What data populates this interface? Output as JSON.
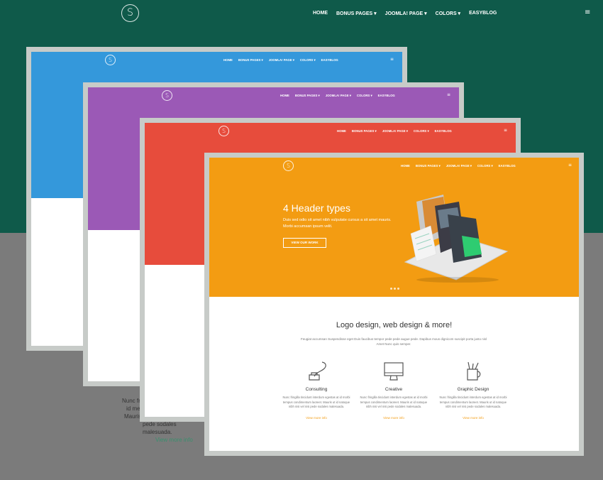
{
  "nav": {
    "logo": "S",
    "items": [
      "HOME",
      "BONUS PAGES ▾",
      "JOOMLA! PAGE ▾",
      "COLORS ▾",
      "EASYBLOG"
    ],
    "menu_icon": "hamburger-menu-icon"
  },
  "background_text": {
    "lines": [
      "Nunc fri",
      "id me",
      "Mauris ut",
      "pede sodales malesuada."
    ],
    "link": "View more info"
  },
  "previews": [
    {
      "color": "#3498db"
    },
    {
      "color": "#9b59b6"
    },
    {
      "color": "#e74c3c"
    },
    {
      "color": "#f39c12"
    }
  ],
  "front": {
    "hero": {
      "title": "4 Header types",
      "text": "Duis sed odio sit amet nibh vulputate cursus a sit amet mauris. Morbi accumsan ipsum velit.",
      "button": "VIEW OUR WORK"
    },
    "section": {
      "title": "Logo design, web design & more!",
      "subtitle": "Feugiat accumsan Suspendisse eget Duis faucibus tempor pede pede augue pede. Dapibus mous dignicom suscipit porta justo nisl Amet Nunc quis semper."
    },
    "features": [
      {
        "title": "Consulting",
        "text": "Nunc fringilla tincidunt interdum egestas at id morbi tempus condimentum laoreet. Mauris ut id natoque nibh nisi vel nisi pede sodales malesuada.",
        "link": "View more info",
        "icon": "quill-inkwell-icon"
      },
      {
        "title": "Creative",
        "text": "Nunc fringilla tincidunt interdum egestas at id morbi tempus condimentum laoreet. Mauris ut id natoque nibh nisi vel nisi pede sodales malesuada.",
        "link": "View more info",
        "icon": "monitor-icon"
      },
      {
        "title": "Graphic Design",
        "text": "Nunc fringilla tincidunt interdum egestas at id morbi tempus condimentum laoreet. Mauris ut id natoque nibh nisi vel nisi pede sodales malesuada.",
        "link": "View more info",
        "icon": "pencil-cup-icon"
      }
    ]
  }
}
